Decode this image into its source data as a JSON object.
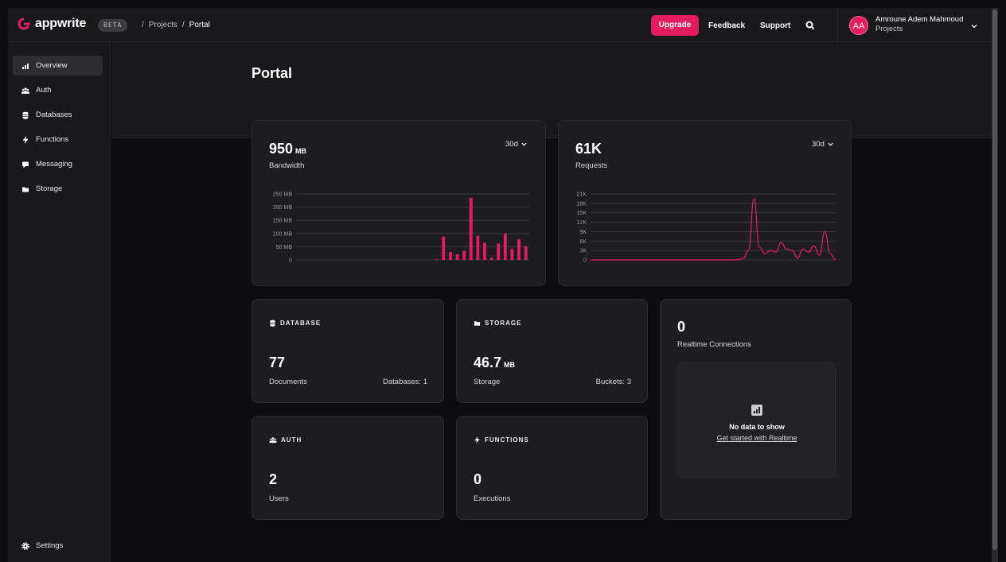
{
  "app": {
    "brand": "appwrite",
    "beta": "BETA",
    "breadcrumb": [
      "/",
      "Projects",
      "/",
      "Portal"
    ],
    "accent_color": "#e31c5f"
  },
  "topbar": {
    "upgrade_label": "Upgrade",
    "feedback_label": "Feedback",
    "support_label": "Support",
    "avatar_initials": "AA",
    "user_name": "Amroune Adem Mahmoud",
    "user_sub": "Projects"
  },
  "sidebar": {
    "items": [
      {
        "label": "Overview",
        "icon": "chart-icon"
      },
      {
        "label": "Auth",
        "icon": "users-icon"
      },
      {
        "label": "Databases",
        "icon": "database-icon"
      },
      {
        "label": "Functions",
        "icon": "lightning-icon"
      },
      {
        "label": "Messaging",
        "icon": "message-icon"
      },
      {
        "label": "Storage",
        "icon": "folder-icon"
      }
    ],
    "settings_label": "Settings"
  },
  "page": {
    "title": "Portal"
  },
  "bandwidth": {
    "value": "950",
    "unit": "MB",
    "label": "Bandwidth",
    "range": "30d"
  },
  "requests": {
    "value": "61K",
    "label": "Requests",
    "range": "30d"
  },
  "database": {
    "head": "DATABASE",
    "value": "77",
    "label": "Documents",
    "extra": "Databases: 1"
  },
  "storage": {
    "head": "STORAGE",
    "value": "46.7",
    "unit": "MB",
    "label": "Storage",
    "extra": "Buckets: 3"
  },
  "auth": {
    "head": "AUTH",
    "value": "2",
    "label": "Users"
  },
  "functions": {
    "head": "FUNCTIONS",
    "value": "0",
    "label": "Executions"
  },
  "realtime": {
    "value": "0",
    "label": "Realtime Connections",
    "empty_title": "No data to show",
    "empty_link": "Get started with Realtime"
  },
  "chart_data": [
    {
      "type": "bar",
      "title": "Bandwidth",
      "ylabel": "",
      "yticks": [
        "0",
        "50 MB",
        "100 MB",
        "150 MB",
        "200 MB",
        "250 MB"
      ],
      "ylim": [
        0,
        250
      ],
      "values": [
        0,
        0,
        0,
        0,
        0,
        0,
        0,
        0,
        0,
        0,
        0,
        0,
        0,
        0,
        0,
        0,
        0,
        0,
        0,
        0,
        2,
        88,
        30,
        22,
        35,
        235,
        92,
        65,
        8,
        62,
        100,
        42,
        78,
        52
      ],
      "color": "#e31c5f"
    },
    {
      "type": "line",
      "title": "Requests",
      "ylabel": "",
      "yticks": [
        "0",
        "3K",
        "6K",
        "9K",
        "12K",
        "15K",
        "18K",
        "21K"
      ],
      "ylim": [
        0,
        21000
      ],
      "values": [
        0,
        0,
        0,
        0,
        0,
        0,
        0,
        0,
        0,
        0,
        0,
        0,
        0,
        0,
        0,
        0,
        0,
        0,
        0,
        0,
        0,
        0,
        0,
        0,
        0,
        0,
        0,
        100,
        400,
        3000,
        19500,
        4000,
        2000,
        3000,
        2500,
        5500,
        3500,
        3000,
        600,
        3500,
        2500,
        4500,
        1500,
        9000,
        2000,
        0
      ],
      "color": "#e31c5f"
    }
  ]
}
